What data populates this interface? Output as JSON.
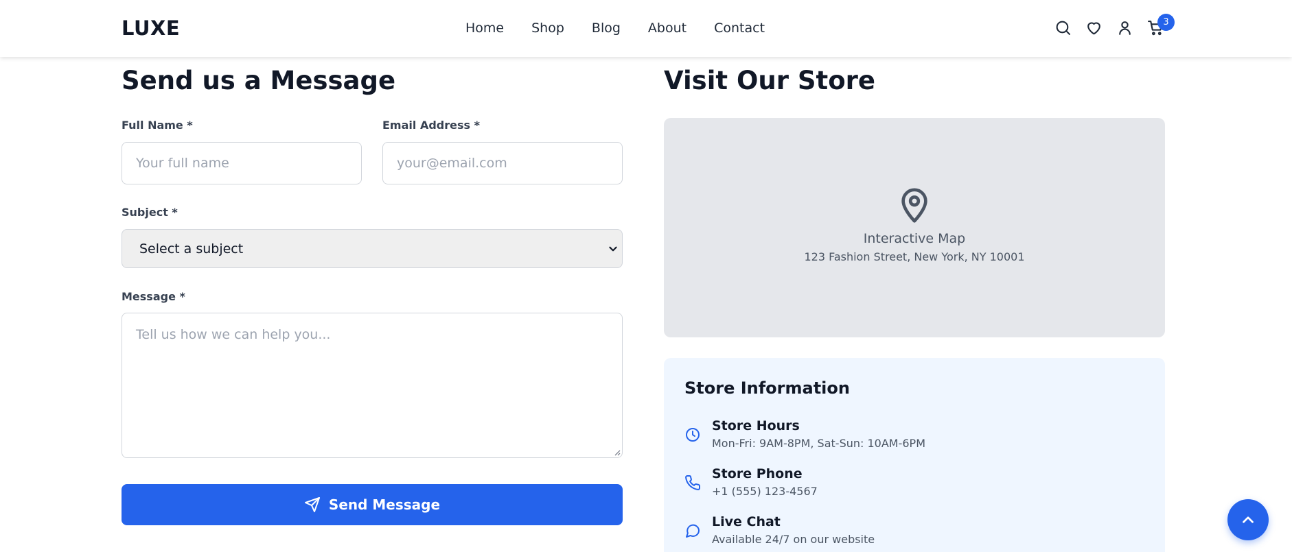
{
  "brand": "LUXE",
  "nav": {
    "items": [
      {
        "label": "Home"
      },
      {
        "label": "Shop"
      },
      {
        "label": "Blog"
      },
      {
        "label": "About"
      },
      {
        "label": "Contact"
      }
    ]
  },
  "header_icons": {
    "search": "search-icon",
    "wishlist": "heart-icon",
    "account": "user-icon",
    "cart": "cart-icon",
    "cart_count": "3"
  },
  "form": {
    "title": "Send us a Message",
    "full_name": {
      "label": "Full Name *",
      "placeholder": "Your full name"
    },
    "email": {
      "label": "Email Address *",
      "placeholder": "your@email.com"
    },
    "subject": {
      "label": "Subject *",
      "selected": "Select a subject"
    },
    "message": {
      "label": "Message *",
      "placeholder": "Tell us how we can help you..."
    },
    "submit_label": "Send Message"
  },
  "store": {
    "title": "Visit Our Store",
    "map": {
      "title": "Interactive Map",
      "address": "123 Fashion Street, New York, NY 10001"
    },
    "info": {
      "title": "Store Information",
      "items": [
        {
          "icon": "clock-icon",
          "title": "Store Hours",
          "detail": "Mon-Fri: 9AM-8PM, Sat-Sun: 10AM-6PM"
        },
        {
          "icon": "phone-icon",
          "title": "Store Phone",
          "detail": "+1 (555) 123-4567"
        },
        {
          "icon": "chat-icon",
          "title": "Live Chat",
          "detail": "Available 24/7 on our website"
        }
      ]
    }
  },
  "colors": {
    "accent": "#2563eb",
    "heading": "#111827",
    "map_bg": "#e5e7eb",
    "info_bg": "#eff6ff"
  }
}
